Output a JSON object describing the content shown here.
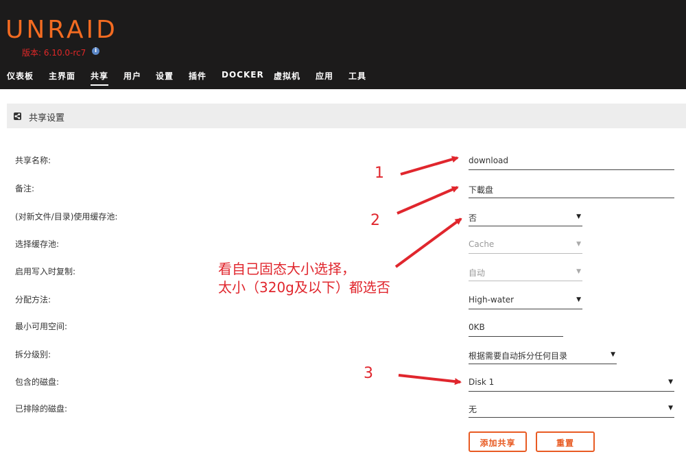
{
  "header": {
    "logo": "UNRAID",
    "version": "版本: 6.10.0-rc7",
    "info_glyph": "i",
    "nav": [
      {
        "label": "仪表板"
      },
      {
        "label": "主界面"
      },
      {
        "label": "共享",
        "active": true
      },
      {
        "label": "用户"
      },
      {
        "label": "设置"
      },
      {
        "label": "插件"
      },
      {
        "label": "DOCKER"
      },
      {
        "label": "虚拟机"
      },
      {
        "label": "应用"
      },
      {
        "label": "工具"
      }
    ]
  },
  "section": {
    "title": "共享设置",
    "icon": "share-icon"
  },
  "form": {
    "share_name_label": "共享名称:",
    "share_name_value": "download",
    "comment_label": "备注:",
    "comment_value": "下載盘",
    "use_cache_label": "(对新文件/目录)使用缓存池:",
    "use_cache_value": "否",
    "select_cache_label": "选择缓存池:",
    "select_cache_value": "Cache",
    "cow_label": "启用写入时复制:",
    "cow_value": "自动",
    "alloc_label": "分配方法:",
    "alloc_value": "High-water",
    "min_free_label": "最小可用空间:",
    "min_free_value": "0KB",
    "split_label": "拆分级别:",
    "split_value": "根据需要自动拆分任何目录",
    "included_label": "包含的磁盘:",
    "included_value": "Disk 1",
    "excluded_label": "已排除的磁盘:",
    "excluded_value": "无",
    "caret": "▼"
  },
  "buttons": {
    "add": "添加共享",
    "reset": "重置"
  },
  "annotations": {
    "n1": "1",
    "n2": "2",
    "n3": "3",
    "note_line1": "看自己固态大小选择，",
    "note_line2": "太小（320g及以下）都选否",
    "color": "#e0262d"
  },
  "colors": {
    "header_bg": "#1c1b1b",
    "brand": "#f36b21",
    "button": "#e85a22"
  }
}
